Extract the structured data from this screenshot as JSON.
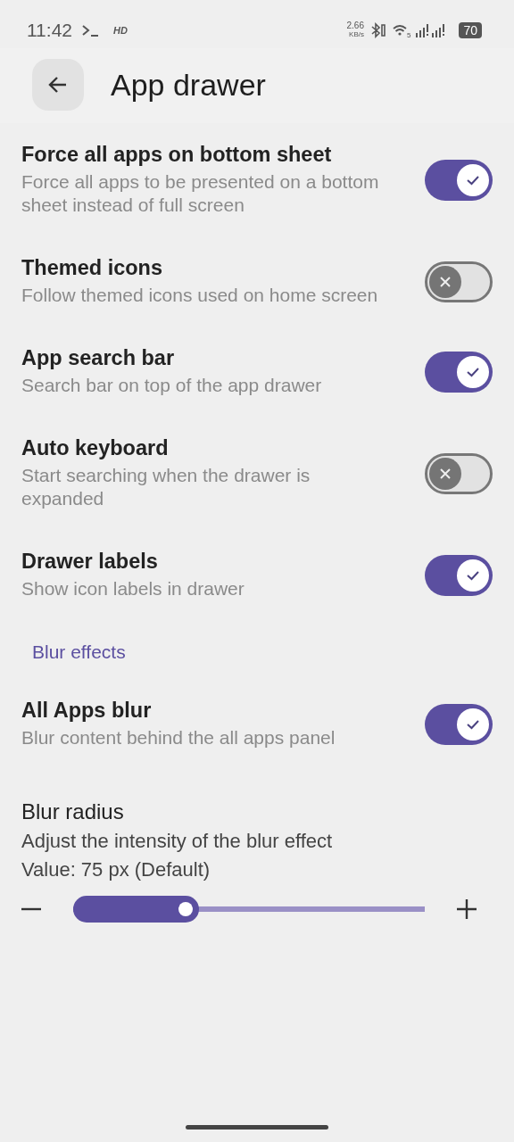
{
  "status_bar": {
    "time": "11:42",
    "hd": "HD",
    "speed": "2.66",
    "speed_unit": "KB/s",
    "wifi_band": "5",
    "battery": "70"
  },
  "header": {
    "title": "App drawer"
  },
  "items": [
    {
      "kind": "toggle",
      "title": "Force all apps on bottom sheet",
      "subtitle": "Force all apps to be presented on a bottom sheet instead of full screen",
      "on": true
    },
    {
      "kind": "toggle",
      "title": "Themed icons",
      "subtitle": "Follow themed icons used on home screen",
      "on": false
    },
    {
      "kind": "toggle",
      "title": "App search bar",
      "subtitle": "Search bar on top of the app drawer",
      "on": true
    },
    {
      "kind": "toggle",
      "title": "Auto keyboard",
      "subtitle": "Start searching when the drawer is expanded",
      "on": false
    },
    {
      "kind": "toggle",
      "title": "Drawer labels",
      "subtitle": "Show icon labels in drawer",
      "on": true
    },
    {
      "kind": "section",
      "title": "Blur effects"
    },
    {
      "kind": "toggle",
      "title": "All Apps blur",
      "subtitle": "Blur content behind the all apps panel",
      "on": true
    },
    {
      "kind": "slider",
      "title": "Blur radius",
      "subtitle": "Adjust the intensity of the blur effect",
      "value": "Value: 75 px (Default)",
      "level": 0.32
    }
  ]
}
